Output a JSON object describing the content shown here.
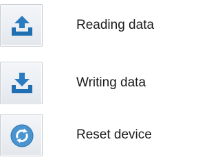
{
  "actions": [
    {
      "label": "Reading data",
      "icon": "upload-tray-icon"
    },
    {
      "label": "Writing data",
      "icon": "download-tray-icon"
    },
    {
      "label": "Reset device",
      "icon": "refresh-icon"
    }
  ],
  "colors": {
    "icon_blue": "#1f6fb2",
    "icon_blue_light": "#4a95cf",
    "button_border": "#c6ccd3",
    "text": "#1a1a1a"
  }
}
